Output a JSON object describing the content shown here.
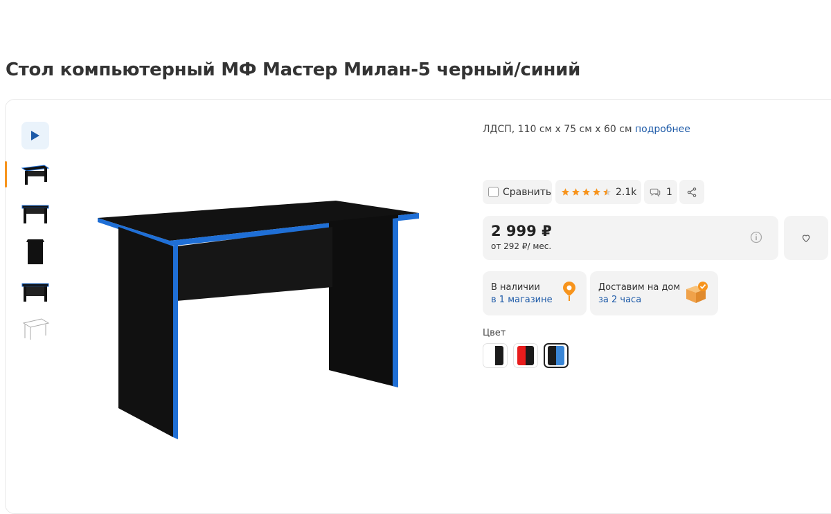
{
  "product": {
    "title": "Стол компьютерный МФ Мастер Милан-5 черный/синий",
    "spec_text": "ЛДСП, 110 см х 75 см х 60 см",
    "spec_more": "подробнее"
  },
  "gallery": {
    "thumbnails": [
      "desk-front",
      "desk-side",
      "desk-end",
      "desk-top",
      "desk-drawing"
    ],
    "active_index": 0
  },
  "actions": {
    "compare_label": "Сравнить",
    "rating_value": 4.5,
    "rating_count": "2.1k",
    "reviews_count": "1"
  },
  "price": {
    "amount": "2 999 ₽",
    "installment": "от 292 ₽/ мес."
  },
  "availability": {
    "stock_label": "В наличии",
    "stock_link": "в 1 магазине",
    "delivery_label": "Доставим на дом",
    "delivery_link": "за 2 часа"
  },
  "colors": {
    "label": "Цвет",
    "options": [
      {
        "name": "white-black",
        "colors": [
          "#ffffff",
          "#1b1b1b"
        ]
      },
      {
        "name": "red-black",
        "colors": [
          "#e81c1c",
          "#1b1b1b"
        ]
      },
      {
        "name": "black-blue",
        "colors": [
          "#1b1b1b",
          "#3a86d6"
        ],
        "selected": true
      }
    ]
  },
  "theme": {
    "accent_orange": "#f7941d",
    "link_blue": "#1d5aa8",
    "desk_black": "#121212",
    "desk_edge_blue": "#1f6fd6"
  }
}
